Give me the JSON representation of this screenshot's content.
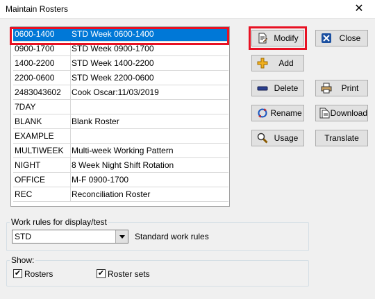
{
  "window": {
    "title": "Maintain Rosters",
    "close_glyph": "✕"
  },
  "rosters": [
    {
      "code": "0600-1400",
      "desc": "STD Week 0600-1400",
      "selected": true
    },
    {
      "code": "0900-1700",
      "desc": "STD Week 0900-1700"
    },
    {
      "code": "1400-2200",
      "desc": "STD Week 1400-2200"
    },
    {
      "code": "2200-0600",
      "desc": "STD Week 2200-0600"
    },
    {
      "code": "2483043602",
      "desc": "Cook Oscar:11/03/2019"
    },
    {
      "code": "7DAY",
      "desc": ""
    },
    {
      "code": "BLANK",
      "desc": "Blank Roster"
    },
    {
      "code": "EXAMPLE",
      "desc": ""
    },
    {
      "code": "MULTIWEEK",
      "desc": "Multi-week Working Pattern"
    },
    {
      "code": "NIGHT",
      "desc": "8 Week Night Shift Rotation"
    },
    {
      "code": "OFFICE",
      "desc": "M-F 0900-1700"
    },
    {
      "code": "REC",
      "desc": "Reconciliation Roster"
    }
  ],
  "buttons": {
    "modify": "Modify",
    "add": "Add",
    "delete": "Delete",
    "rename": "Rename",
    "usage": "Usage",
    "close": "Close",
    "print": "Print",
    "download": "Download",
    "translate": "Translate"
  },
  "work_rules": {
    "legend": "Work rules for display/test",
    "selected": "STD",
    "description": "Standard work rules"
  },
  "show": {
    "legend": "Show:",
    "rosters_label": "Rosters",
    "rosters_checked": true,
    "roster_sets_label": "Roster sets",
    "roster_sets_checked": true
  },
  "accent": {
    "selection": "#0078d7",
    "highlight_frame": "#e81123"
  }
}
